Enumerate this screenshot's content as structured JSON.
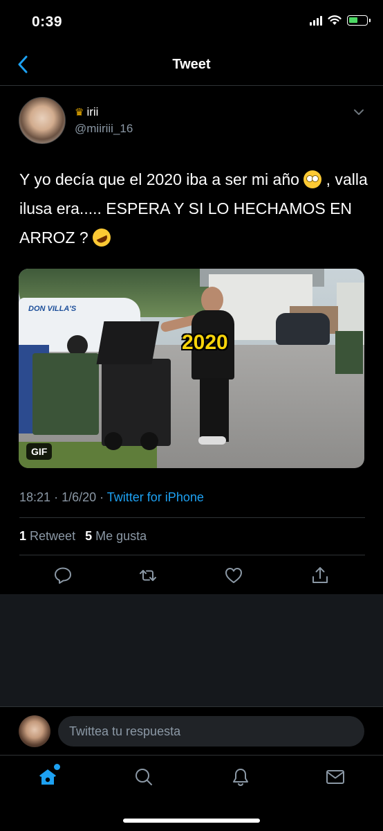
{
  "status_bar": {
    "time": "0:39"
  },
  "nav": {
    "title": "Tweet"
  },
  "tweet": {
    "author_name": "irii",
    "author_handle": "@miiriii_16",
    "text_part1": "Y yo decía que el 2020 iba a ser mi año ",
    "text_part2": " , valla ilusa era..... ESPERA Y SI LO HECHAMOS EN ARROZ ? ",
    "media": {
      "overlay_text": "2020",
      "badge": "GIF",
      "van_text": "DON VILLA'S"
    },
    "time": "18:21",
    "date": "1/6/20",
    "source": "Twitter for iPhone",
    "retweet_count": "1",
    "retweet_label": "Retweet",
    "like_count": "5",
    "like_label": "Me gusta"
  },
  "reply": {
    "placeholder": "Twittea tu respuesta"
  },
  "tabs": [
    "home-icon",
    "search-icon",
    "notifications-icon",
    "messages-icon"
  ],
  "colors": {
    "accent": "#1da1f2",
    "background": "#000000",
    "secondary_text": "#8b98a5",
    "divider": "#2f3336"
  }
}
